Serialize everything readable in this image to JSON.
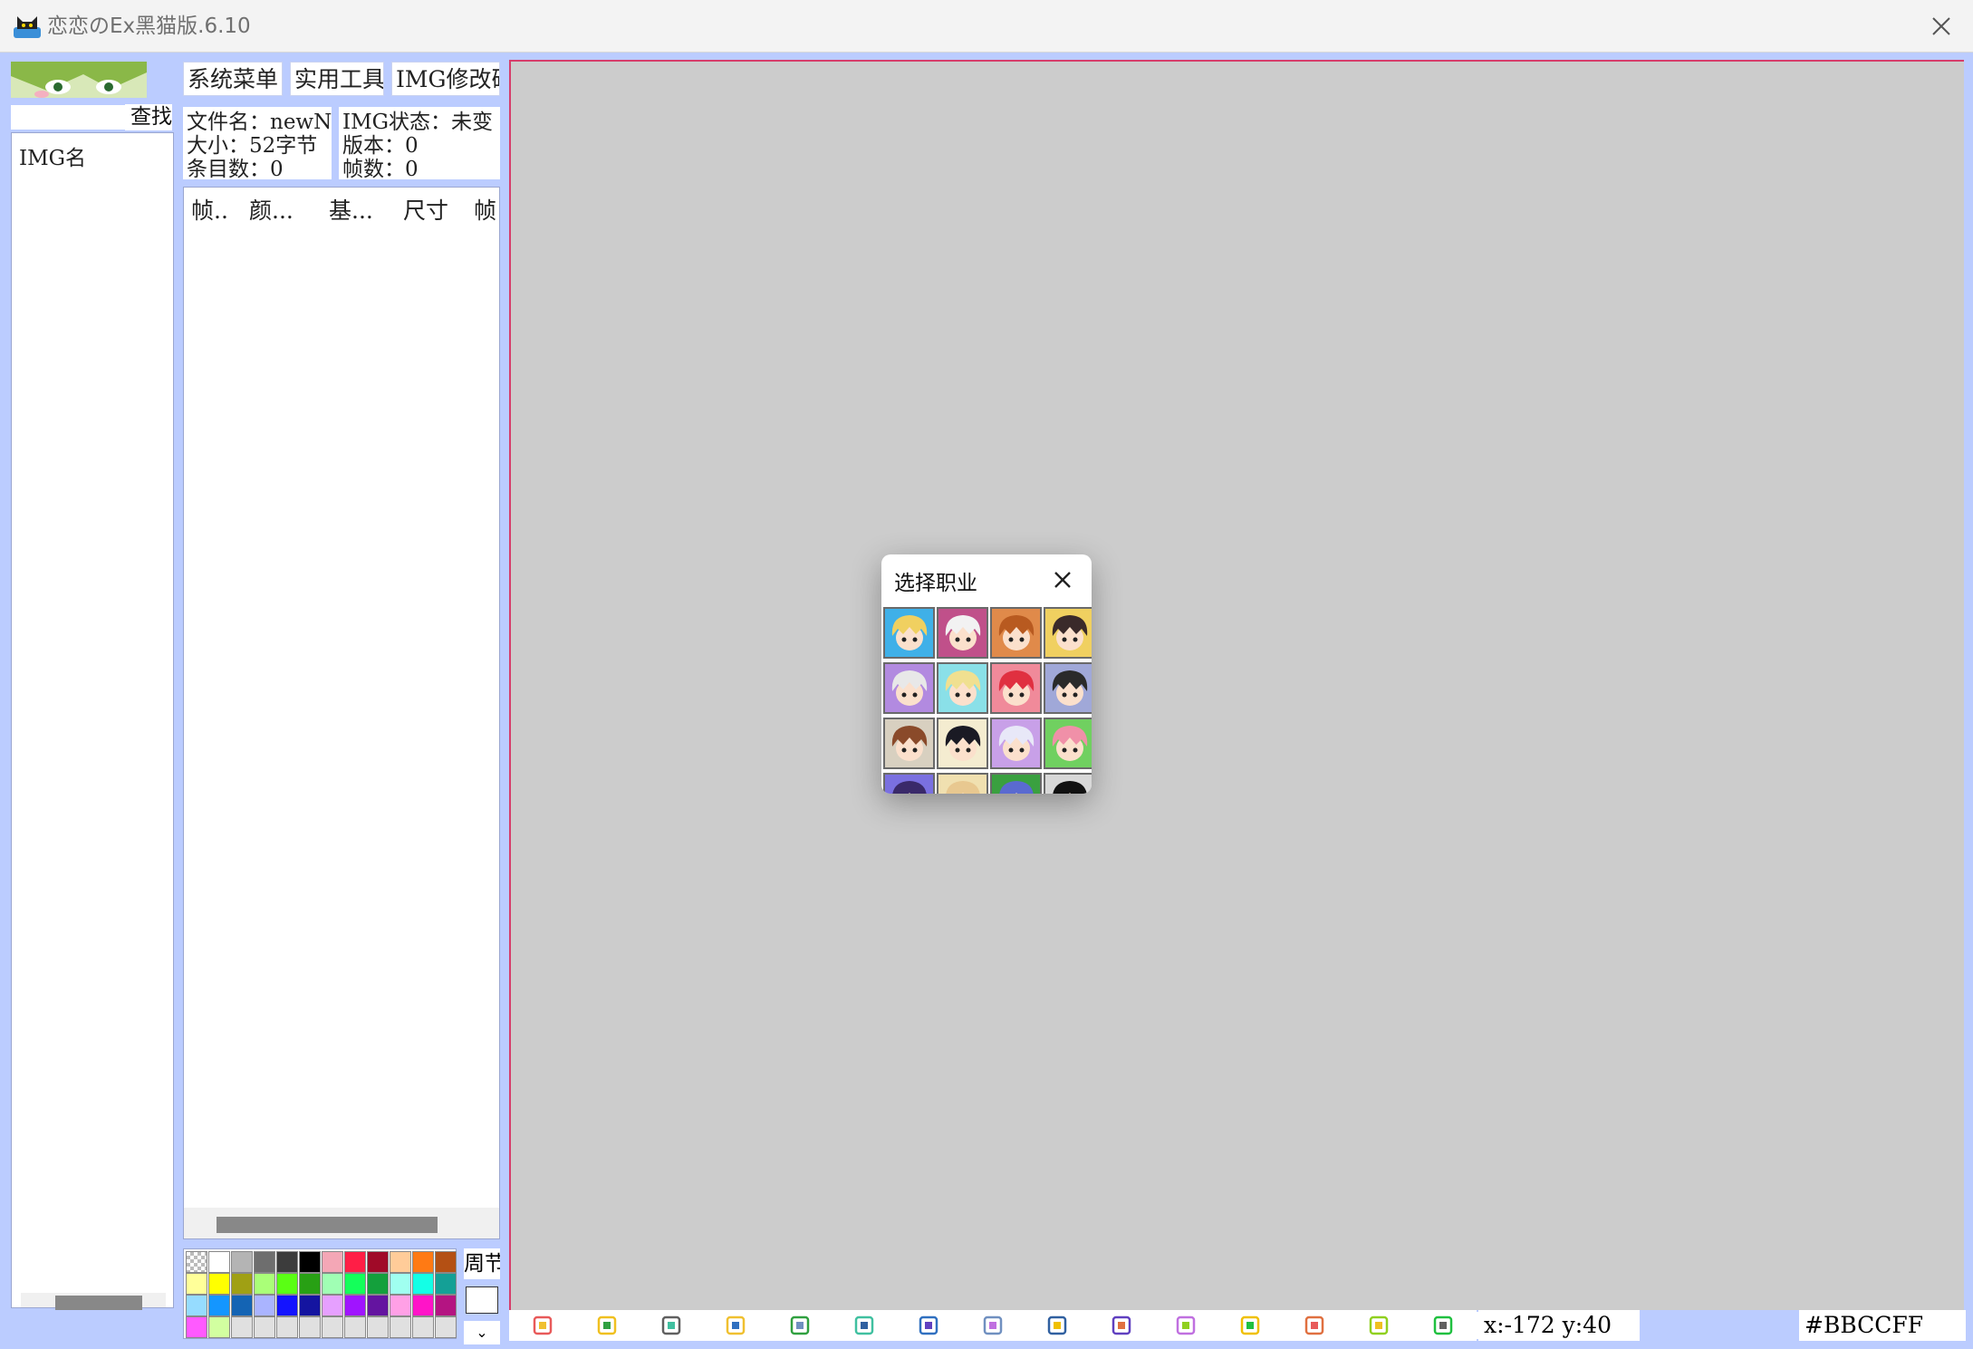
{
  "window": {
    "title": "恋恋のEx黑猫版.6.10"
  },
  "left": {
    "search_button": "查找",
    "list_header": "IMG名"
  },
  "menu": {
    "system": "系统菜单",
    "tools": "实用工具",
    "img_confirm": "IMG修改确认"
  },
  "file_info": {
    "name": "文件名：newNPK",
    "size": "大小：52字节",
    "count": "条目数：0"
  },
  "img_info": {
    "state": "IMG状态：未变",
    "version": "版本：0",
    "frames": "帧数：0"
  },
  "frame_table": {
    "columns": [
      "帧..",
      "颜...",
      "基...",
      "尺寸",
      "帧"
    ]
  },
  "palette": {
    "rows": [
      [
        "#ffffff",
        "#ffffff",
        "#b4b4b4",
        "#6e6e6e",
        "#3c3c3c",
        "#000000",
        "#f4a7b6",
        "#ff1e46",
        "#a00a28",
        "#ffcc99",
        "#ff7a14",
        "#b45014"
      ],
      [
        "#ffff99",
        "#ffff00",
        "#a0a014",
        "#aaff78",
        "#5aff14",
        "#28a014",
        "#a0ffb4",
        "#14ff5a",
        "#14a03c",
        "#a0fff0",
        "#14ffe6",
        "#14a096"
      ],
      [
        "#96dcff",
        "#1496ff",
        "#1464b4",
        "#aab4ff",
        "#1414ff",
        "#1414a0",
        "#e6a0ff",
        "#a014ff",
        "#6414a0",
        "#ffa0e6",
        "#ff14c8",
        "#b41482"
      ],
      [
        "#ff5aff",
        "#d2ffa0",
        "#e0e0e0",
        "#e0e0e0",
        "#e0e0e0",
        "#e0e0e0",
        "#e0e0e0",
        "#e0e0e0",
        "#e0e0e0",
        "#e0e0e0",
        "#e0e0e0",
        "#e0e0e0"
      ]
    ]
  },
  "side": {
    "label": "周节",
    "arrow": "⌄"
  },
  "dialog": {
    "title": "选择职业",
    "jobs": [
      {
        "bg": "#3fb0e8",
        "hair": "#f0d060"
      },
      {
        "bg": "#c0508a",
        "hair": "#f2f2f2"
      },
      {
        "bg": "#e08a4a",
        "hair": "#b85a20"
      },
      {
        "bg": "#f0d060",
        "hair": "#3a2a2a"
      },
      {
        "bg": "#b28ae0",
        "hair": "#e8e8e8"
      },
      {
        "bg": "#8ae0e8",
        "hair": "#f0e090"
      },
      {
        "bg": "#f08a9a",
        "hair": "#e03040"
      },
      {
        "bg": "#a0a8d8",
        "hair": "#2a2a2a"
      },
      {
        "bg": "#d8d0c0",
        "hair": "#8a4a2a"
      },
      {
        "bg": "#f4ecd0",
        "hair": "#1a1a24"
      },
      {
        "bg": "#c8a0e8",
        "hair": "#e8e8f8"
      },
      {
        "bg": "#70d060",
        "hair": "#f090a8"
      },
      {
        "bg": "#7a70e0",
        "hair": "#3a2a6a"
      },
      {
        "bg": "#f0e0b0",
        "hair": "#e8c890"
      },
      {
        "bg": "#3aa040",
        "hair": "#5a6ad0"
      },
      {
        "bg": "#d8d8d8",
        "hair": "#111111"
      }
    ]
  },
  "toolbar": {
    "tools": [
      "record-icon",
      "palette-icon",
      "grid-icon",
      "cat-icon",
      "film-icon",
      "cloud-icon",
      "zoom-icon",
      "crop-person-icon",
      "crop-icon",
      "pen-icon",
      "line-icon",
      "rect-icon",
      "eraser-icon",
      "picker-icon",
      "tag-icon"
    ]
  },
  "status": {
    "coords": "x:-172 y:40",
    "color_hex": "#BBCCFF"
  }
}
